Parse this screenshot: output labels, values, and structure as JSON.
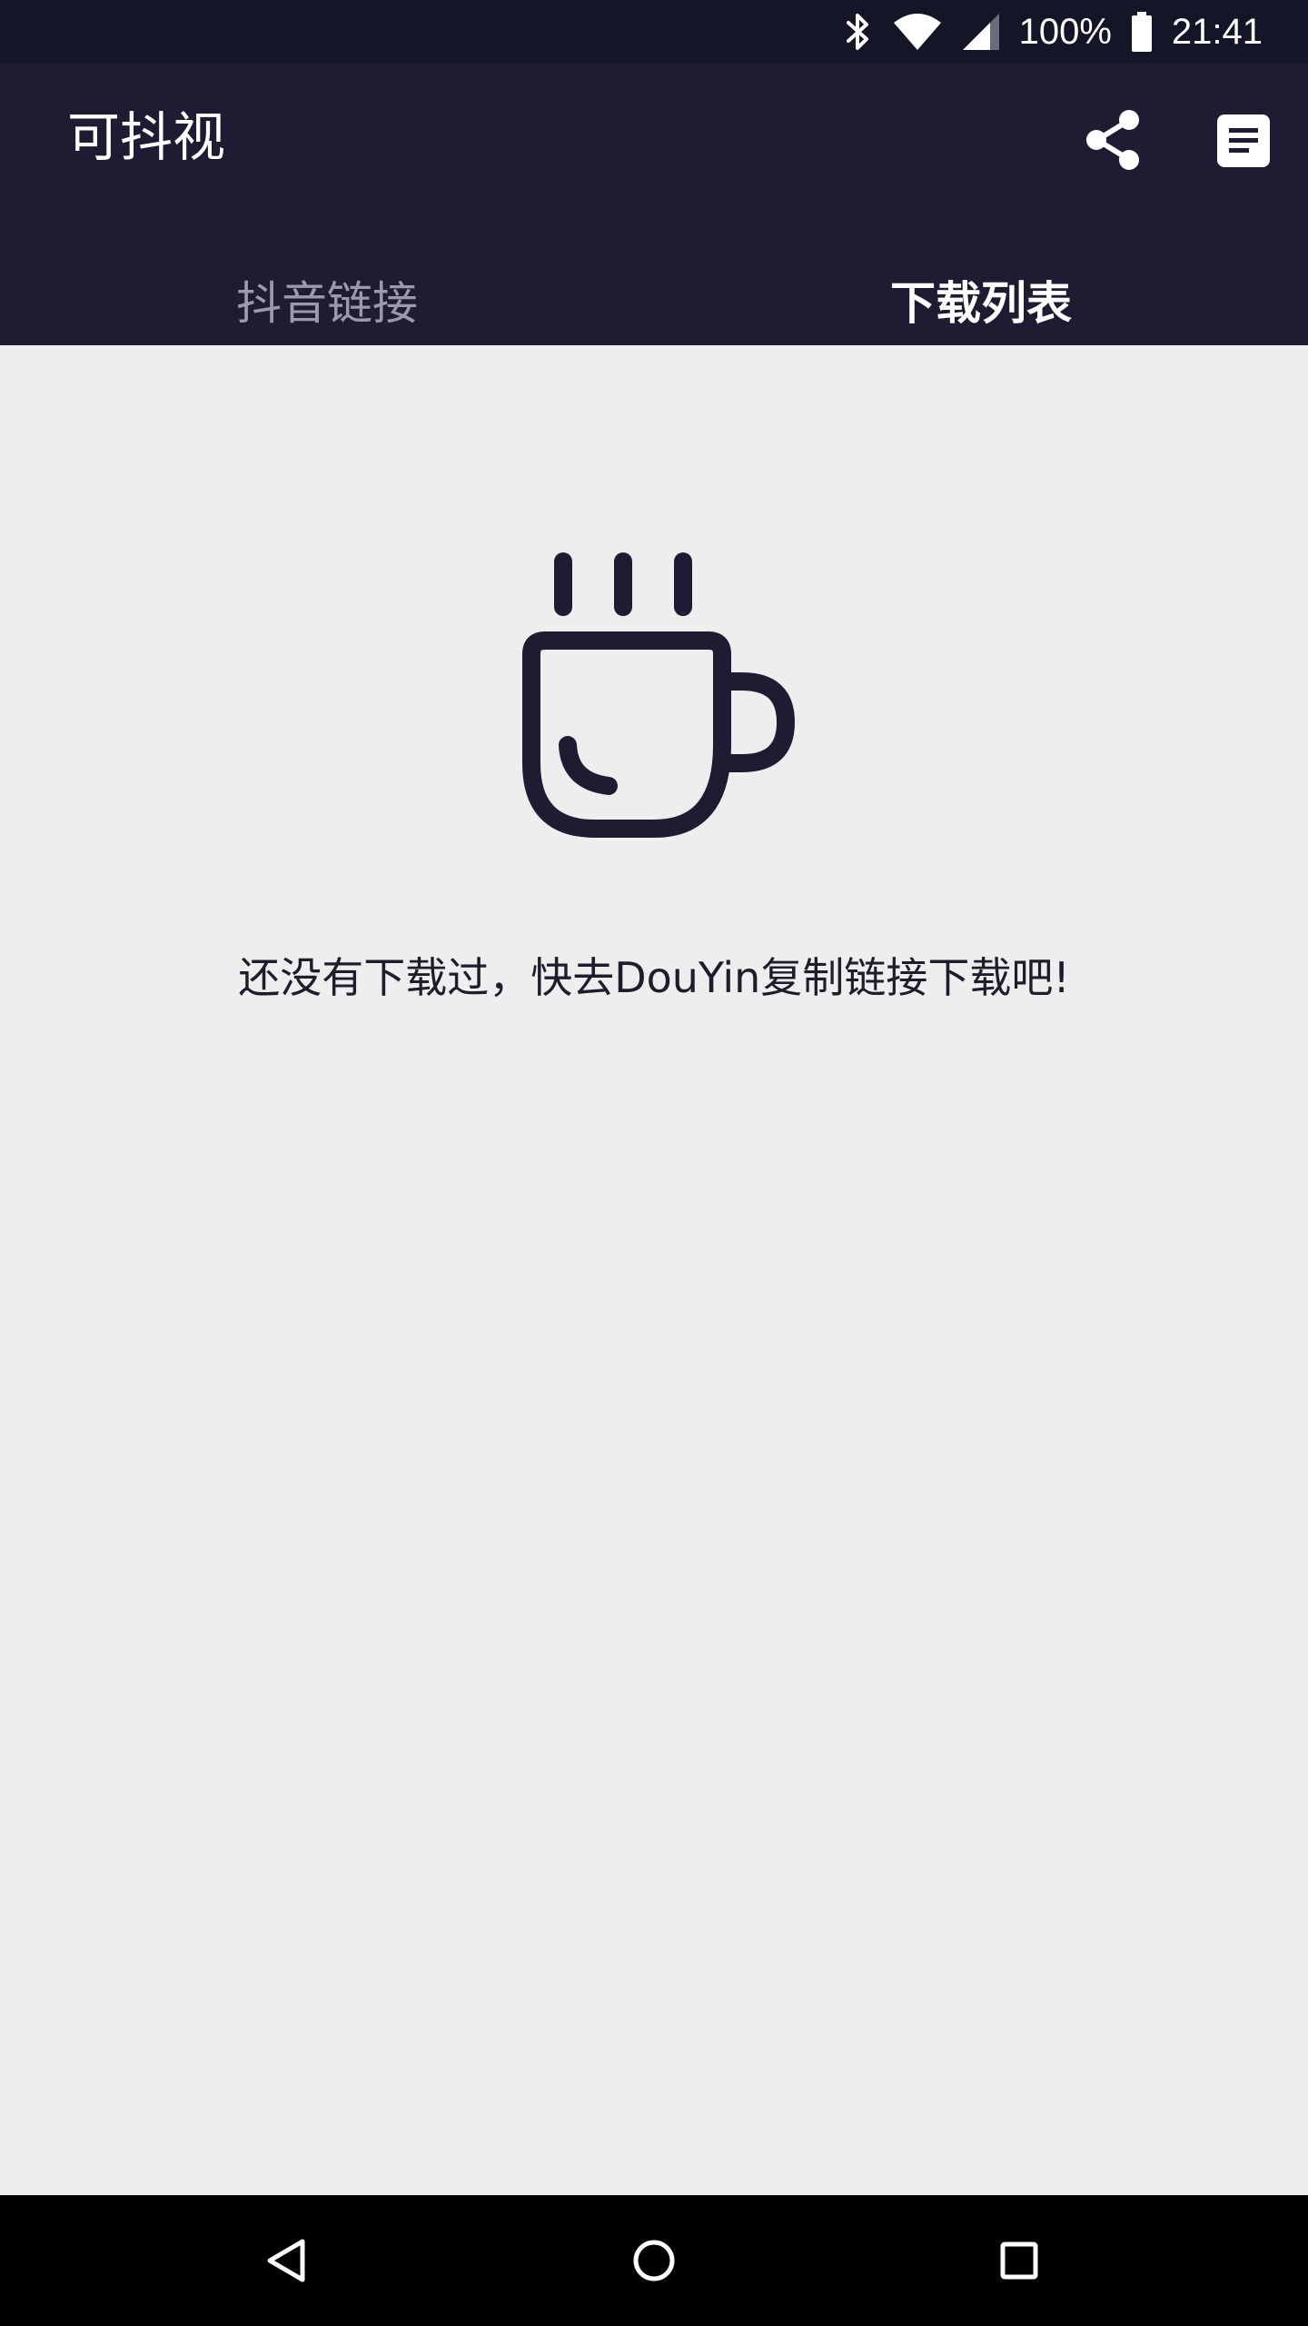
{
  "status_bar": {
    "battery_percent": "100%",
    "time": "21:41",
    "icons": [
      "bluetooth-icon",
      "wifi-icon",
      "signal-icon",
      "battery-icon"
    ]
  },
  "app_bar": {
    "title": "可抖视",
    "actions": [
      "share-icon",
      "list-icon"
    ],
    "background_color": "#1e1c33"
  },
  "tabs": [
    {
      "label": "抖音链接",
      "selected": false
    },
    {
      "label": "下载列表",
      "selected": true
    }
  ],
  "empty_state": {
    "icon": "coffee-cup-icon",
    "message": "还没有下载过，快去DouYin复制链接下载吧!"
  },
  "nav_bar": {
    "buttons": [
      "back-icon",
      "home-icon",
      "recents-icon"
    ]
  }
}
